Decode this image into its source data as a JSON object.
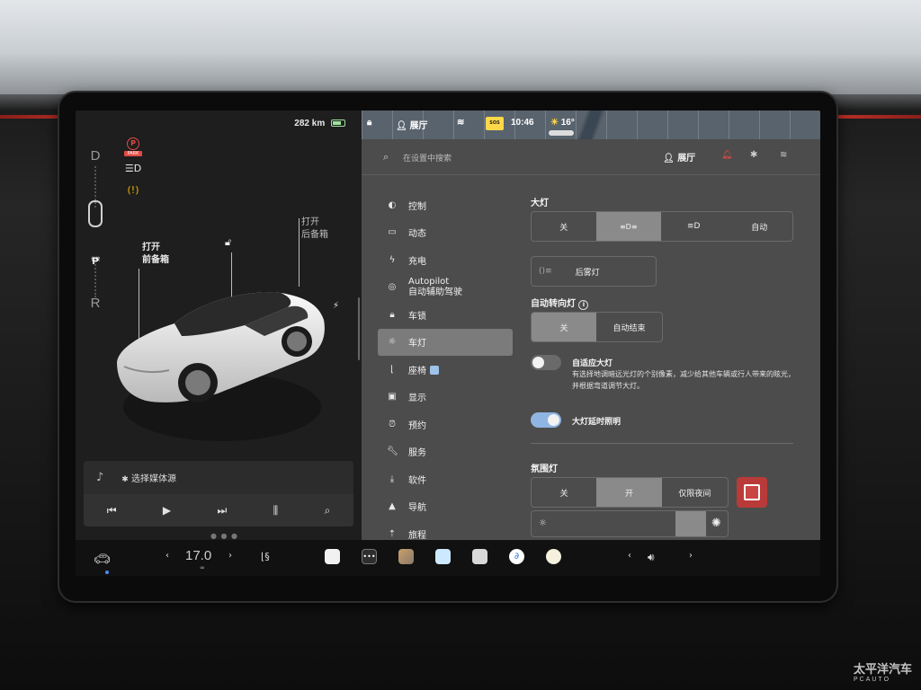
{
  "car_panel": {
    "range": "282 km",
    "gears": [
      "D",
      "P",
      "R"
    ],
    "gear_p_sub": "长按",
    "park_label": "PARK",
    "frunk_line1": "打开",
    "frunk_line2": "前备箱",
    "trunk_line1": "打开",
    "trunk_line2": "后备箱",
    "media_source": "选择媒体源"
  },
  "status_bar": {
    "profile": "展厅",
    "sos": "SOS",
    "time": "10:46",
    "temperature": "16°"
  },
  "settings": {
    "search_placeholder": "在设置中搜索",
    "profile": "展厅",
    "nav": [
      {
        "label": "控制",
        "icon": "toggle-icon"
      },
      {
        "label": "动态",
        "icon": "car-icon"
      },
      {
        "label": "充电",
        "icon": "bolt-icon"
      },
      {
        "label": "Autopilot",
        "label2": "自动辅助驾驶",
        "icon": "steering-wheel-icon"
      },
      {
        "label": "车锁",
        "icon": "lock-icon"
      },
      {
        "label": "车灯",
        "icon": "light-icon",
        "active": true
      },
      {
        "label": "座椅",
        "icon": "seat-icon"
      },
      {
        "label": "显示",
        "icon": "display-icon"
      },
      {
        "label": "预约",
        "icon": "alarm-icon"
      },
      {
        "label": "服务",
        "icon": "wrench-icon"
      },
      {
        "label": "软件",
        "icon": "download-icon"
      },
      {
        "label": "导航",
        "icon": "navigation-icon"
      },
      {
        "label": "旅程",
        "icon": "trip-icon"
      }
    ],
    "headlights": {
      "title": "大灯",
      "options": [
        "关",
        "",
        "",
        "自动"
      ],
      "selected": 1,
      "fog_label": "后雾灯"
    },
    "auto_high_beam": {
      "title": "自动转向灯",
      "options": [
        "关",
        "自动结束"
      ],
      "selected": 0
    },
    "adaptive_headlights": {
      "title": "自适应大灯",
      "desc": "有选择地调暗远光灯的个别像素，减少给其他车辆或行人带来的眩光，并根据弯道调节大灯。",
      "enabled": false
    },
    "headlights_after_exit": {
      "title": "大灯延时照明",
      "enabled": true
    },
    "ambient": {
      "title": "氛围灯",
      "options": [
        "关",
        "开",
        "仅限夜间"
      ],
      "selected": 1,
      "color": "#c94645"
    }
  },
  "taskbar": {
    "temperature": "17.0"
  },
  "watermark": {
    "brand": "太平洋汽车",
    "sub": "PCAUTO"
  }
}
